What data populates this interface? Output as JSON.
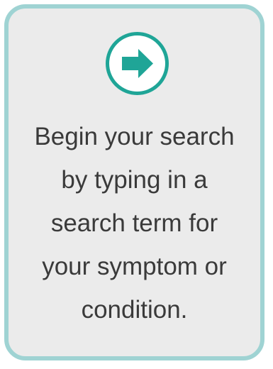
{
  "card": {
    "icon": "right-arrow-icon",
    "accent_color": "#1fa597",
    "border_color": "#9fd3d3",
    "background_color": "#ebebeb",
    "message_lines": [
      "Begin your search",
      "by typing in a",
      "search term for",
      "your symptom or",
      "condition."
    ]
  }
}
